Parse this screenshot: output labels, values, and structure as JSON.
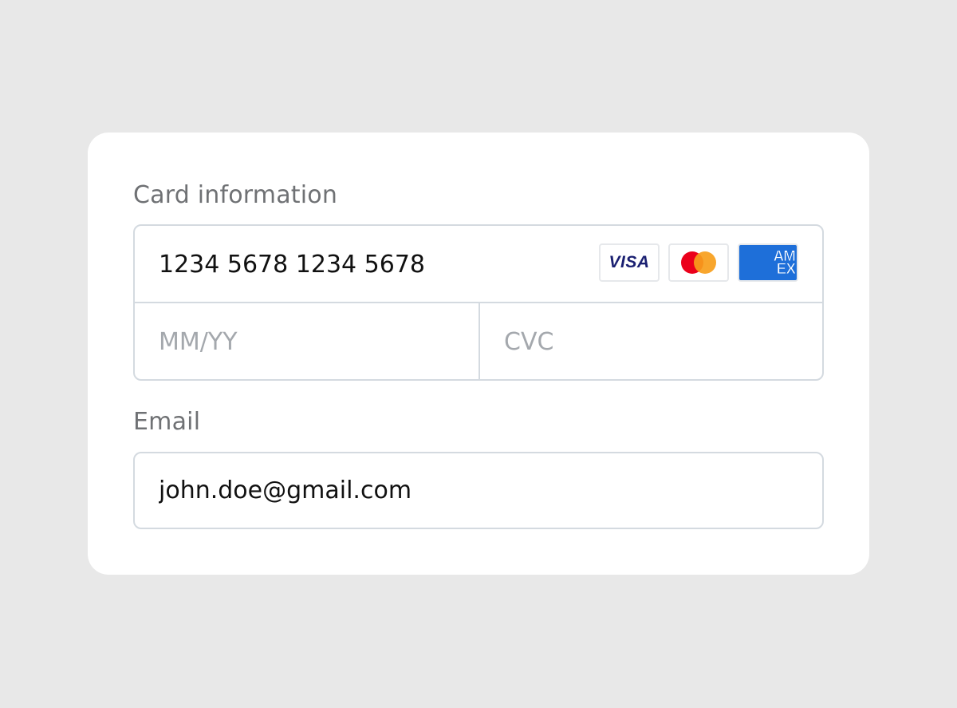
{
  "form": {
    "card_info_label": "Card information",
    "card_number_value": "1234 5678 1234 5678",
    "expiry_placeholder": "MM/YY",
    "cvc_placeholder": "CVC",
    "email_label": "Email",
    "email_value": "john.doe@gmail.com"
  },
  "card_brands": {
    "visa_text": "VISA",
    "amex_line1": "AM",
    "amex_line2": "EX",
    "icons": [
      "visa-icon",
      "mastercard-icon",
      "amex-icon"
    ]
  },
  "colors": {
    "page_background": "#e8e8e8",
    "card_background": "#ffffff",
    "label_text": "#6f7174",
    "input_border": "#d4dae0",
    "placeholder_text": "#a4a8ad",
    "value_text": "#111111",
    "visa_blue": "#1a1f71",
    "mastercard_red": "#eb001b",
    "mastercard_orange": "#f79e1b",
    "amex_blue": "#1e6fd9"
  }
}
